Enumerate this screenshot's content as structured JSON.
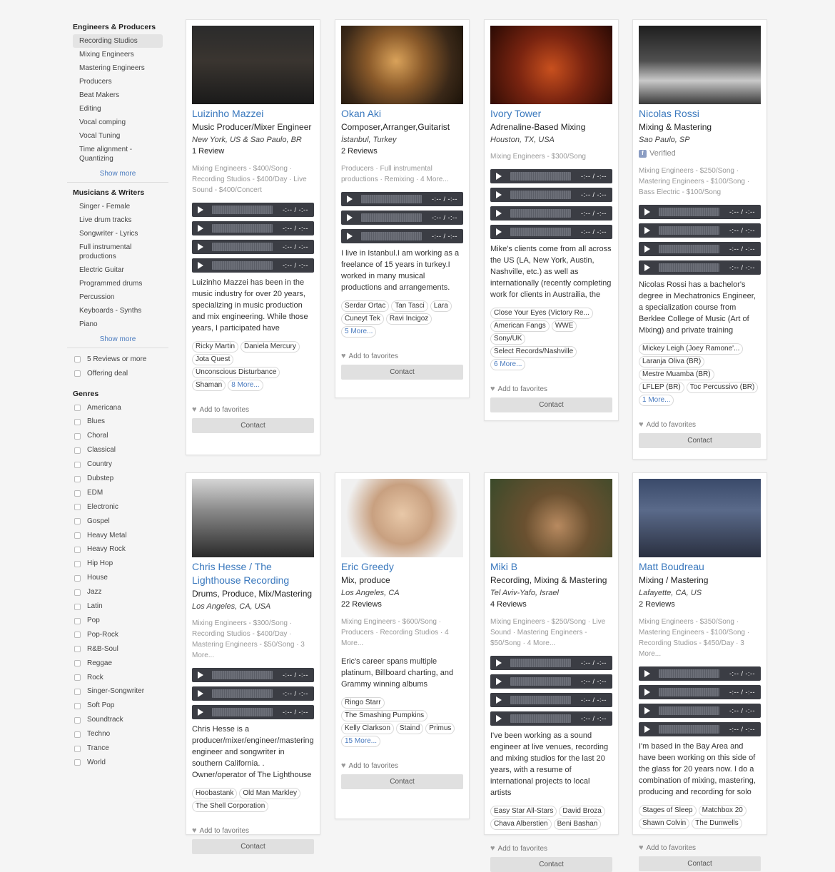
{
  "sidebar": {
    "engineers_heading": "Engineers & Producers",
    "engineers": [
      "Recording Studios",
      "Mixing Engineers",
      "Mastering Engineers",
      "Producers",
      "Beat Makers",
      "Editing",
      "Vocal comping",
      "Vocal Tuning",
      "Time alignment - Quantizing"
    ],
    "show_more": "Show more",
    "musicians_heading": "Musicians & Writers",
    "musicians": [
      "Singer - Female",
      "Live drum tracks",
      "Songwriter - Lyrics",
      "Full instrumental productions",
      "Electric Guitar",
      "Programmed drums",
      "Percussion",
      "Keyboards - Synths",
      "Piano"
    ],
    "filters": [
      "5 Reviews or more",
      "Offering deal"
    ],
    "genres_heading": "Genres",
    "genres": [
      "Americana",
      "Blues",
      "Choral",
      "Classical",
      "Country",
      "Dubstep",
      "EDM",
      "Electronic",
      "Gospel",
      "Heavy Metal",
      "Heavy Rock",
      "Hip Hop",
      "House",
      "Jazz",
      "Latin",
      "Pop",
      "Pop-Rock",
      "R&B-Soul",
      "Reggae",
      "Rock",
      "Singer-Songwriter",
      "Soft Pop",
      "Soundtrack",
      "Techno",
      "Trance",
      "World"
    ]
  },
  "player_time": "-:-- / -:--",
  "fav_label": "Add to favorites",
  "contact_label": "Contact",
  "cards": [
    {
      "name": "Luizinho Mazzei",
      "role": "Music Producer/Mixer Engineer",
      "location": "New York, US & Sao Paulo, BR",
      "reviews": "1 Review",
      "services": "Mixing Engineers - $400/Song · Recording Studios - $400/Day · Live Sound - $400/Concert",
      "description": "Luizinho Mazzei has been in the music industry for over 20 years, specializing in music production and mix engineering. While those years, I participated have",
      "tags": [
        "Ricky Martin",
        "Daniela Mercury",
        "Jota Quest",
        "Unconscious Disturbance",
        "Shaman"
      ],
      "more": "8 More..."
    },
    {
      "name": "Okan Aki",
      "role": "Composer,Arranger,Guitarist",
      "location": "İstanbul, Turkey",
      "reviews": "2 Reviews",
      "services": "Producers · Full instrumental productions · Remixing · 4 More...",
      "description": "I live in Istanbul.I am working as a freelance of 15 years in turkey.I worked in many musical productions and arrangements.",
      "tags": [
        "Serdar Ortac",
        "Tan Tasci",
        "Lara",
        "Cuneyt Tek",
        "Ravi Incigoz"
      ],
      "more": "5 More..."
    },
    {
      "name": "Ivory Tower",
      "role": "Adrenaline-Based Mixing",
      "location": "Houston, TX, USA",
      "reviews": "",
      "services": "Mixing Engineers - $300/Song",
      "description": "Mike's clients come from all across the US (LA, New York, Austin, Nashville, etc.) as well as internationally (recently completing work for clients in Austrailia, the",
      "tags": [
        "Close Your Eyes (Victory Re...",
        "American Fangs",
        "WWE",
        "Sony/UK",
        "Select Records/Nashville"
      ],
      "more": "6 More..."
    },
    {
      "name": "Nicolas Rossi",
      "role": "Mixing & Mastering",
      "location": "Sao Paulo, SP",
      "verified": "Verified",
      "reviews": "",
      "services": "Mixing Engineers - $250/Song · Mastering Engineers - $100/Song · Bass Electric - $100/Song",
      "description": "Nicolas Rossi has a bachelor's degree in Mechatronics Engineer, a specialization course from Berklee College of Music (Art of Mixing) and private training",
      "tags": [
        "Mickey Leigh (Joey Ramone'...",
        "Laranja Oliva (BR)",
        "Mestre Muamba (BR)",
        "LFLEP (BR)",
        "Toc Percussivo (BR)"
      ],
      "more": "1 More..."
    },
    {
      "name": "Chris Hesse / The Lighthouse Recording",
      "role": "Drums, Produce, Mix/Mastering",
      "location": "Los Angeles, CA, USA",
      "reviews": "",
      "services": "Mixing Engineers - $300/Song · Recording Studios - $400/Day · Mastering Engineers - $50/Song · 3 More...",
      "description": "Chris Hesse is a producer/mixer/engineer/mastering engineer and songwriter in southern California. . Owner/operator of The Lighthouse",
      "tags": [
        "Hoobastank",
        "Old Man Markley",
        "The Shell Corporation"
      ],
      "more": ""
    },
    {
      "name": "Eric Greedy",
      "role": "Mix, produce",
      "location": "Los Angeles, CA",
      "reviews": "22 Reviews",
      "services": "Mixing Engineers - $600/Song · Producers · Recording Studios · 4 More...",
      "description": "Eric's career spans multiple platinum, Billboard charting, and Grammy winning albums",
      "tags": [
        "Ringo Starr",
        "The Smashing Pumpkins",
        "Kelly Clarkson",
        "Staind",
        "Primus"
      ],
      "more": "15 More..."
    },
    {
      "name": "Miki B",
      "role": "Recording, Mixing & Mastering",
      "location": "Tel Aviv-Yafo, Israel",
      "reviews": "4 Reviews",
      "services": "Mixing Engineers - $250/Song · Live Sound · Mastering Engineers - $50/Song · 4 More...",
      "description": "I've been working as a sound engineer at live venues, recording and mixing studios for the last 20 years, with a resume of international projects to local artists",
      "tags": [
        "Easy Star All-Stars",
        "David Broza",
        "Chava Alberstien",
        "Beni Bashan"
      ],
      "more": ""
    },
    {
      "name": "Matt Boudreau",
      "role": "Mixing / Mastering",
      "location": "Lafayette, CA, US",
      "reviews": "2 Reviews",
      "services": "Mixing Engineers - $350/Song · Mastering Engineers - $100/Song · Recording Studios - $450/Day · 3 More...",
      "description": "I'm based in the Bay Area and have been working on this side of the glass for 20 years now. I do a combination of mixing, mastering, producing and recording for solo",
      "tags": [
        "Stages of Sleep",
        "Matchbox 20",
        "Shawn Colvin",
        "The Dunwells"
      ],
      "more": ""
    }
  ]
}
